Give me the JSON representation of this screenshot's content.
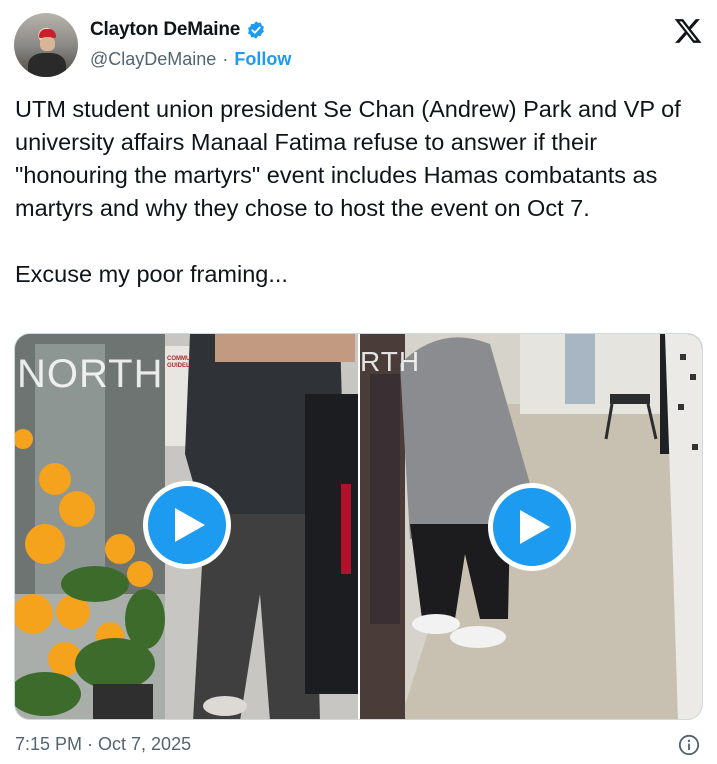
{
  "author": {
    "name": "Clayton DeMaine",
    "handle": "@ClayDeMaine",
    "separator": "·",
    "follow_label": "Follow"
  },
  "tweet": {
    "paragraph1": "UTM student union president Se Chan (Andrew) Park and VP of university affairs Manaal Fatima refuse to answer if their \"honouring the martyrs\" event includes Hamas combatants as martyrs and why they chose to host the event on Oct 7.",
    "paragraph2": "Excuse my poor framing..."
  },
  "media": {
    "left_watermark": "NORTH",
    "right_watermark": "RTH",
    "left_sign_text": "COMMU GUIDEL"
  },
  "footer": {
    "timestamp": "7:15 PM · Oct 7, 2025"
  },
  "icons": {
    "verified": "verified-badge-icon",
    "platform": "x-logo-icon",
    "play": "play-icon",
    "info": "info-icon"
  },
  "colors": {
    "accent": "#1d9bf0",
    "text": "#0f1419",
    "secondary": "#536471"
  }
}
